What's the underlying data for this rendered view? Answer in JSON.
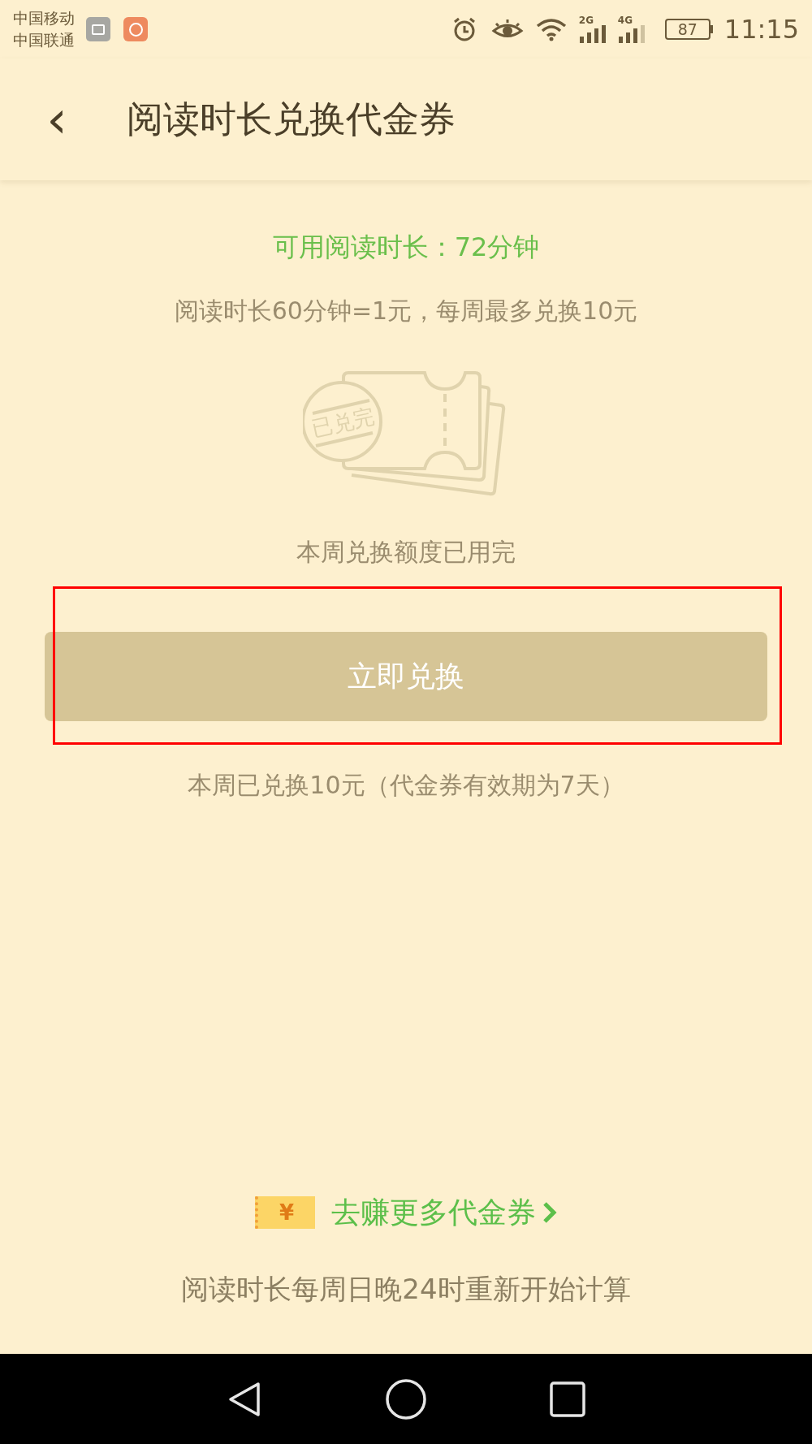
{
  "status_bar": {
    "carriers": [
      "中国移动",
      "中国联通"
    ],
    "network_labels": [
      "2G",
      "4G"
    ],
    "battery": "87",
    "time": "11:15"
  },
  "header": {
    "back": "‹",
    "title": "阅读时长兑换代金券"
  },
  "available": "可用阅读时长：72分钟",
  "rate": "阅读时长60分钟=1元，每周最多兑换10元",
  "illustration": {
    "stamp": "已兑完"
  },
  "quota_message": "本周兑换额度已用完",
  "exchange_button": {
    "label": "立即兑换",
    "disabled": true,
    "highlighted": true
  },
  "note": "本周已兑换10元（代金券有效期为7天）",
  "earn_link": {
    "icon": "¥",
    "label": "去赚更多代金券"
  },
  "footer": "阅读时长每周日晚24时重新开始计算"
}
